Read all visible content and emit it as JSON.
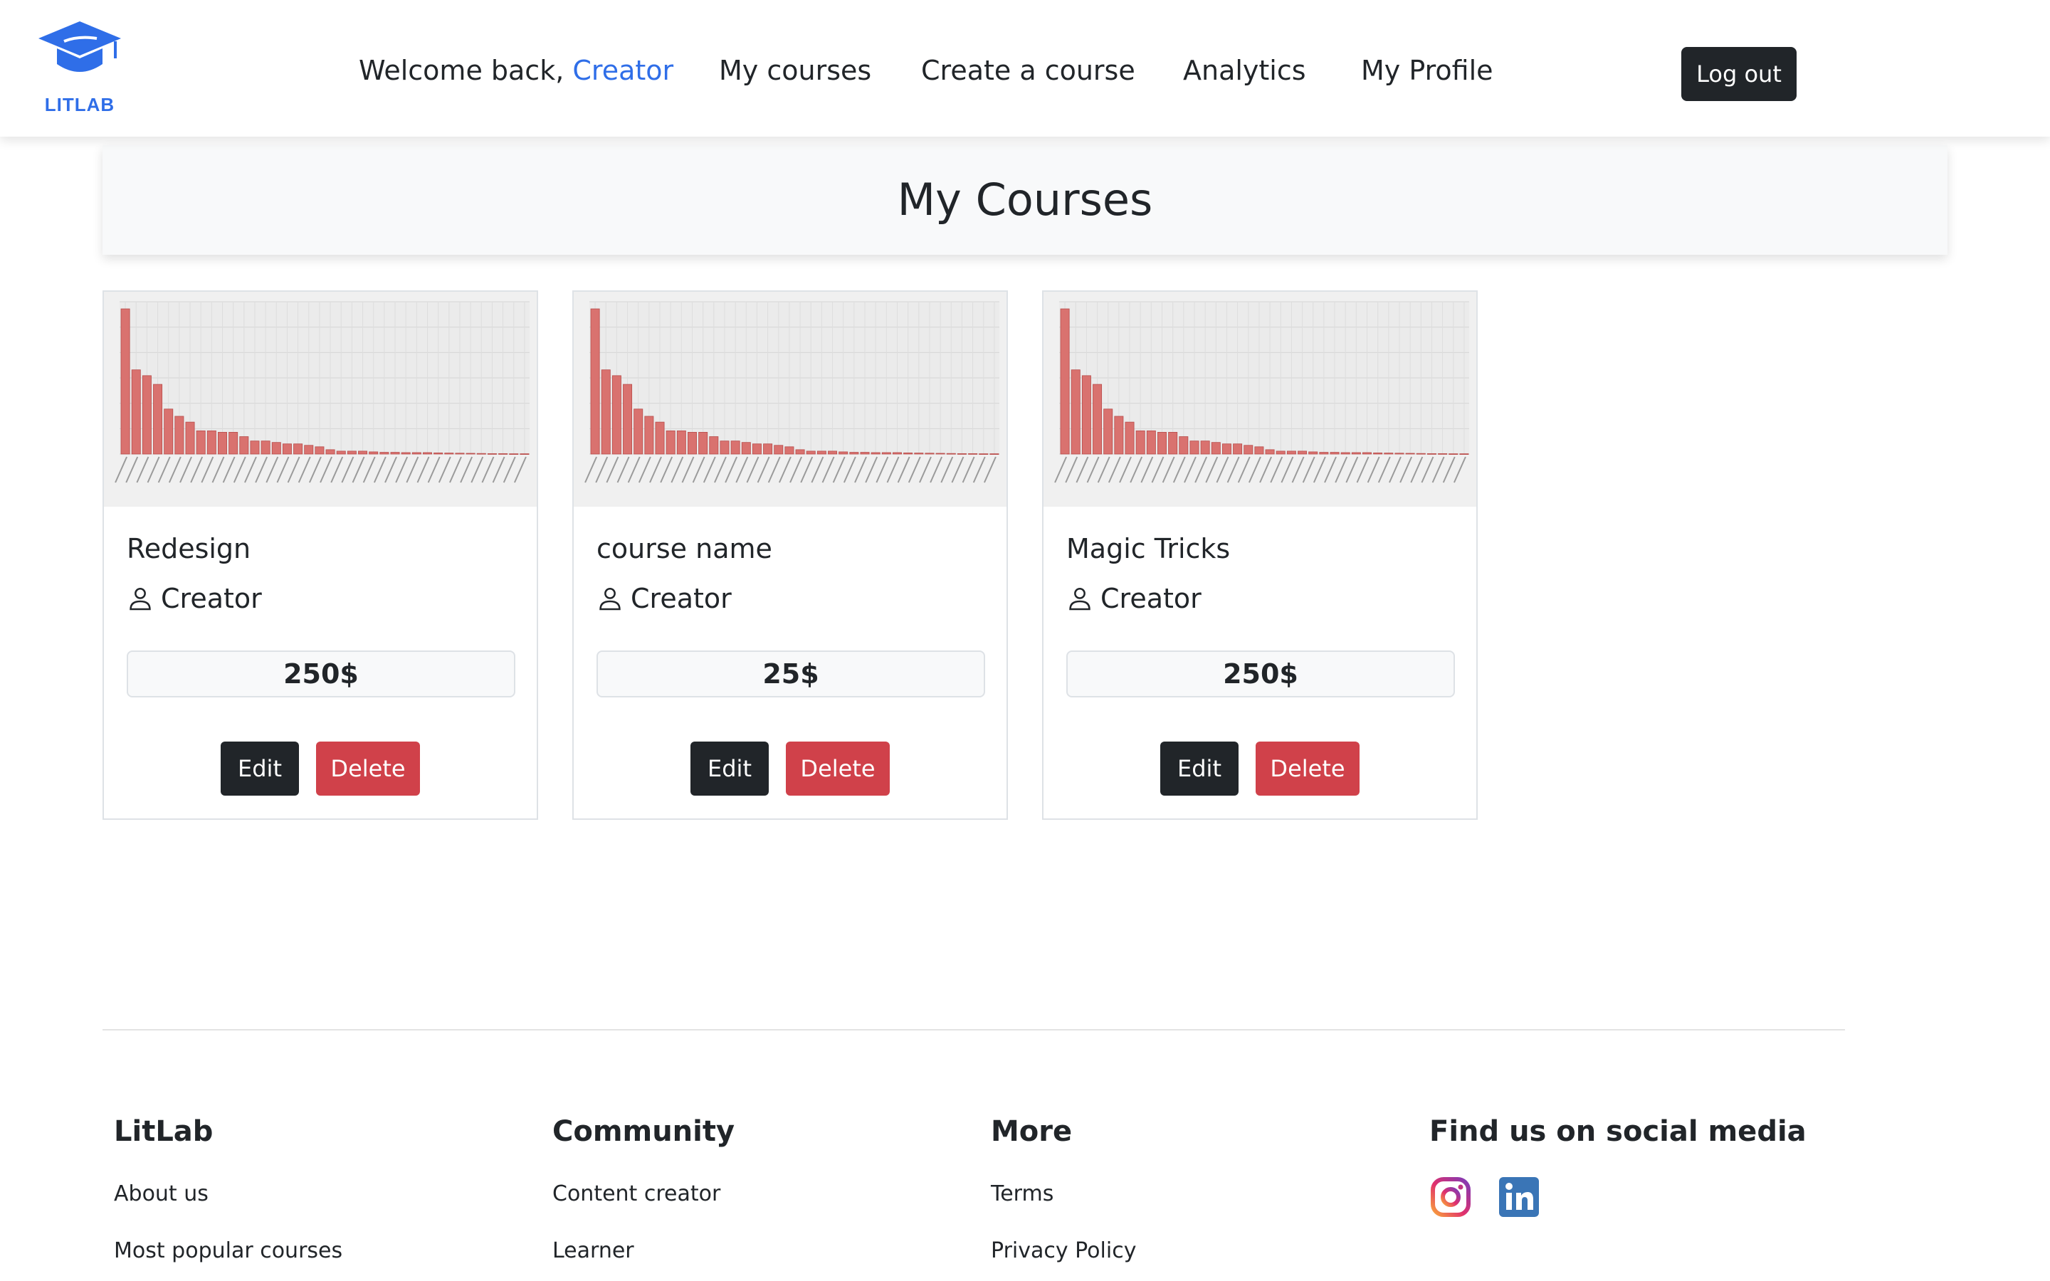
{
  "header": {
    "logo_text": "LITLAB",
    "welcome_prefix": "Welcome back, ",
    "welcome_name": "Creator",
    "nav": [
      "My courses",
      "Create a course",
      "Analytics",
      "My Profile"
    ],
    "logout_label": "Log out"
  },
  "page_title": "My Courses",
  "courses": [
    {
      "title": "Redesign",
      "author": "Creator",
      "price": "250$",
      "edit_label": "Edit",
      "delete_label": "Delete"
    },
    {
      "title": "course name",
      "author": "Creator",
      "price": "25$",
      "edit_label": "Edit",
      "delete_label": "Delete"
    },
    {
      "title": "Magic Tricks",
      "author": "Creator",
      "price": "250$",
      "edit_label": "Edit",
      "delete_label": "Delete"
    }
  ],
  "thumbnail_bar_values": [
    1.0,
    0.58,
    0.54,
    0.48,
    0.31,
    0.26,
    0.22,
    0.16,
    0.16,
    0.15,
    0.15,
    0.12,
    0.09,
    0.09,
    0.08,
    0.07,
    0.07,
    0.06,
    0.05,
    0.03,
    0.02,
    0.02,
    0.02,
    0.015,
    0.012,
    0.012,
    0.01,
    0.01,
    0.01,
    0.008,
    0.007,
    0.006,
    0.005,
    0.004,
    0.003,
    0.003,
    0.002,
    0.002
  ],
  "footer": {
    "columns": [
      {
        "title": "LitLab",
        "links": [
          "About us",
          "Most popular courses"
        ]
      },
      {
        "title": "Community",
        "links": [
          "Content creator",
          "Learner"
        ]
      },
      {
        "title": "More",
        "links": [
          "Terms",
          "Privacy Policy"
        ]
      },
      {
        "title": "Find us on social media",
        "links": []
      }
    ],
    "social_icons": [
      "instagram-icon",
      "linkedin-icon"
    ]
  },
  "colors": {
    "accent": "#2f6ee8",
    "dark": "#212529",
    "danger": "#d0414a",
    "bar": "#d9726f"
  }
}
